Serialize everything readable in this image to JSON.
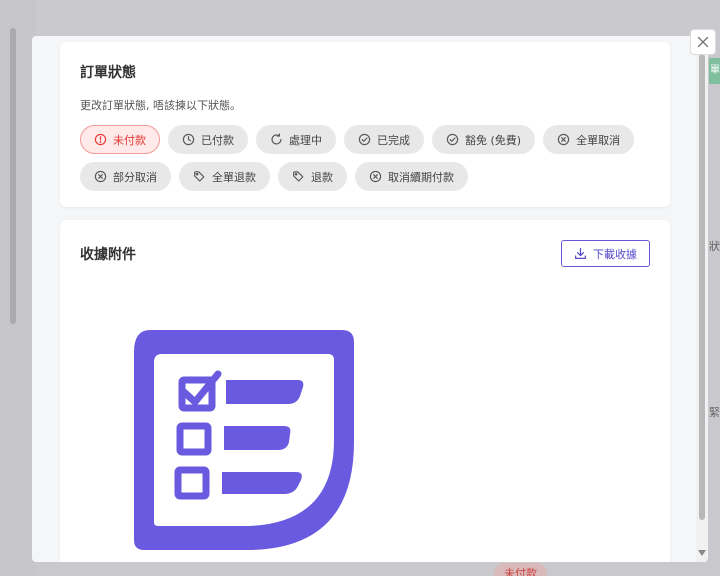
{
  "background": {
    "right_tab_text": "單",
    "right_fragments": [
      "狀",
      "緊"
    ],
    "bottom_badge": "未付款"
  },
  "status_card": {
    "title": "訂單狀態",
    "description": "更改訂單狀態, 唔該揀以下狀態。",
    "options": [
      {
        "label": "未付款",
        "icon": "alert-circle-icon",
        "active": true
      },
      {
        "label": "已付款",
        "icon": "clock-icon",
        "active": false
      },
      {
        "label": "處理中",
        "icon": "refresh-icon",
        "active": false
      },
      {
        "label": "已完成",
        "icon": "check-circle-icon",
        "active": false
      },
      {
        "label": "豁免 (免費)",
        "icon": "check-circle-icon",
        "active": false
      },
      {
        "label": "全單取消",
        "icon": "x-circle-icon",
        "active": false
      },
      {
        "label": "部分取消",
        "icon": "x-circle-icon",
        "active": false
      },
      {
        "label": "全單退款",
        "icon": "tag-icon",
        "active": false
      },
      {
        "label": "退款",
        "icon": "tag-icon",
        "active": false
      },
      {
        "label": "取消續期付款",
        "icon": "x-circle-icon",
        "active": false
      }
    ]
  },
  "receipt_card": {
    "title": "收據附件",
    "download_label": "下載收據"
  },
  "colors": {
    "accent": "#6a5ae0",
    "danger": "#e53935"
  }
}
